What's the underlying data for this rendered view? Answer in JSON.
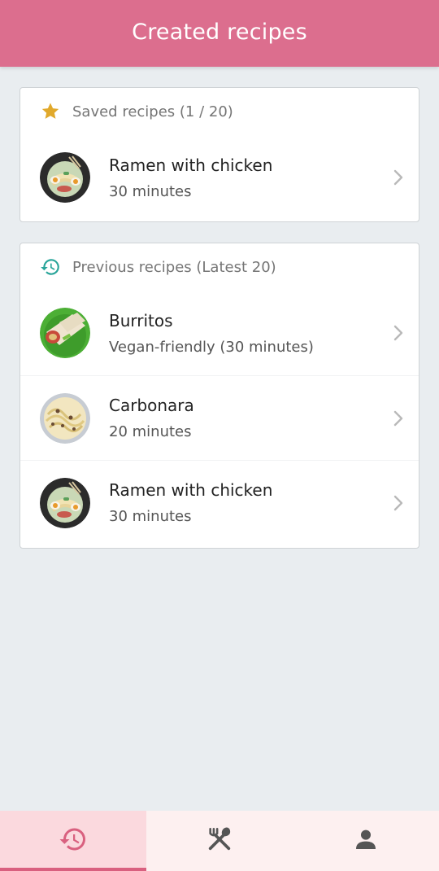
{
  "header": {
    "title": "Created recipes"
  },
  "saved": {
    "heading": "Saved recipes (1 / 20)",
    "icon": "star-icon",
    "items": [
      {
        "title": "Ramen with chicken",
        "subtitle": "30 minutes",
        "image": "ramen"
      }
    ]
  },
  "previous": {
    "heading": "Previous recipes (Latest 20)",
    "icon": "history-icon",
    "items": [
      {
        "title": "Burritos",
        "subtitle": "Vegan-friendly (30 minutes)",
        "image": "burrito"
      },
      {
        "title": "Carbonara",
        "subtitle": "20 minutes",
        "image": "carbonara"
      },
      {
        "title": "Ramen with chicken",
        "subtitle": "30 minutes",
        "image": "ramen"
      }
    ]
  },
  "bottom_nav": {
    "tabs": [
      {
        "icon": "history-icon",
        "active": true
      },
      {
        "icon": "fork-knife-icon",
        "active": false
      },
      {
        "icon": "person-icon",
        "active": false
      }
    ]
  },
  "colors": {
    "header": "#dc6e8e",
    "background": "#e9edf0",
    "star": "#e1a92c",
    "history_icon": "#2aa59a",
    "active_tab": "#fbd9de",
    "active_indicator": "#d9607f"
  }
}
